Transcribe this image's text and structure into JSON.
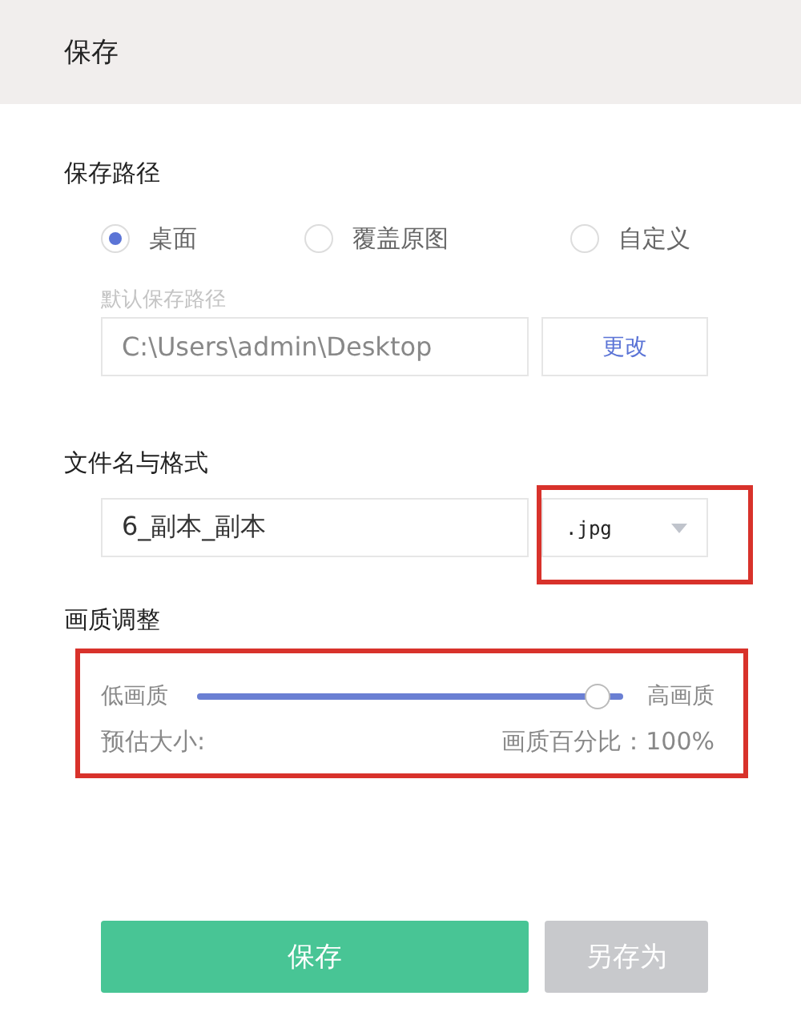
{
  "header": {
    "title": "保存"
  },
  "save_path": {
    "label": "保存路径",
    "options": [
      {
        "label": "桌面",
        "selected": true
      },
      {
        "label": "覆盖原图",
        "selected": false
      },
      {
        "label": "自定义",
        "selected": false
      }
    ],
    "path_caption": "默认保存路径",
    "path_value": "C:\\Users\\admin\\Desktop",
    "change_button": "更改"
  },
  "file": {
    "label": "文件名与格式",
    "name_value": "6_副本_副本",
    "format": ".jpg"
  },
  "quality": {
    "label": "画质调整",
    "low_label": "低画质",
    "high_label": "高画质",
    "level": 1,
    "size_label": "预估大小:",
    "percent_label": "画质百分比：100%"
  },
  "buttons": [
    {
      "label": "保存",
      "kind": "primary"
    },
    {
      "label": "另存为",
      "kind": "secondary"
    }
  ]
}
